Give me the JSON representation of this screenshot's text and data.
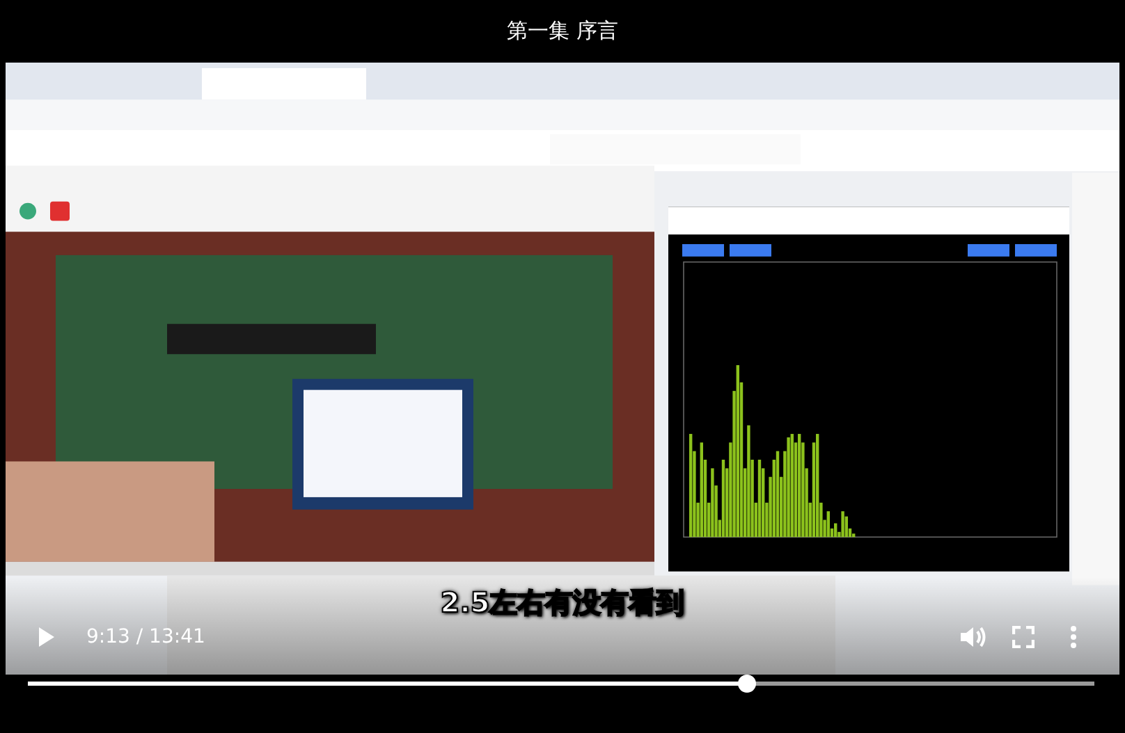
{
  "title": "第一集 序言",
  "subtitle": "2.5左右有没有看到",
  "player": {
    "time": "9:13 / 13:41",
    "playing": false,
    "progress": {
      "level": 0.673
    }
  }
}
